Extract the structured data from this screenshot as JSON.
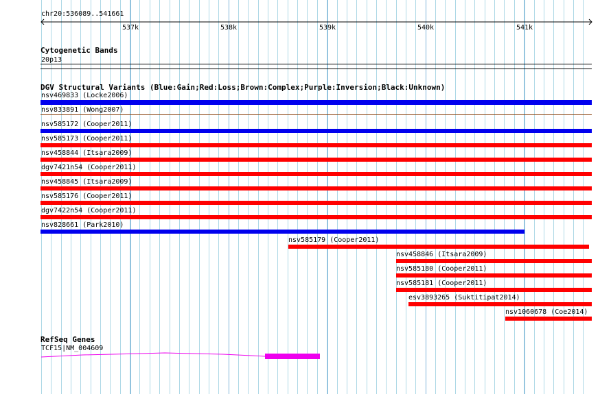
{
  "colors": {
    "gain": "#0000ee",
    "loss": "#ff0000",
    "complex": "#8b4513",
    "gene": "#ee00ee",
    "grid": "#add8e6"
  },
  "ruler": {
    "position_label": "chr20:536089..541661",
    "ticks": [
      "537k",
      "538k",
      "539k",
      "540k",
      "541k"
    ]
  },
  "cytoband": {
    "title": "Cytogenetic Bands",
    "band": "20p13"
  },
  "dgv": {
    "title": "DGV Structural Variants (Blue:Gain;Red:Loss;Brown:Complex;Purple:Inversion;Black:Unknown)",
    "variants": [
      {
        "label": "nsv469833 (Locke2006)",
        "type": "gain"
      },
      {
        "label": "nsv833891 (Wong2007)",
        "type": "complex"
      },
      {
        "label": "nsv585172 (Cooper2011)",
        "type": "gain"
      },
      {
        "label": "nsv585173 (Cooper2011)",
        "type": "loss"
      },
      {
        "label": "nsv458844 (Itsara2009)",
        "type": "loss"
      },
      {
        "label": "dgv7421n54 (Cooper2011)",
        "type": "loss"
      },
      {
        "label": "nsv458845 (Itsara2009)",
        "type": "loss"
      },
      {
        "label": "nsv585176 (Cooper2011)",
        "type": "loss"
      },
      {
        "label": "dgv7422n54 (Cooper2011)",
        "type": "loss"
      },
      {
        "label": "nsv828661 (Park2010)",
        "type": "gain"
      },
      {
        "label": "nsv585179 (Cooper2011)",
        "type": "loss"
      },
      {
        "label": "nsv458846 (Itsara2009)",
        "type": "loss"
      },
      {
        "label": "nsv585180 (Cooper2011)",
        "type": "loss"
      },
      {
        "label": "nsv585181 (Cooper2011)",
        "type": "loss"
      },
      {
        "label": "esv3893265 (Suktitipat2014)",
        "type": "loss"
      },
      {
        "label": "nsv1060678 (Coe2014)",
        "type": "loss"
      }
    ]
  },
  "refseq": {
    "title": "RefSeq Genes",
    "gene_label": "TCF15|NM_004609"
  }
}
